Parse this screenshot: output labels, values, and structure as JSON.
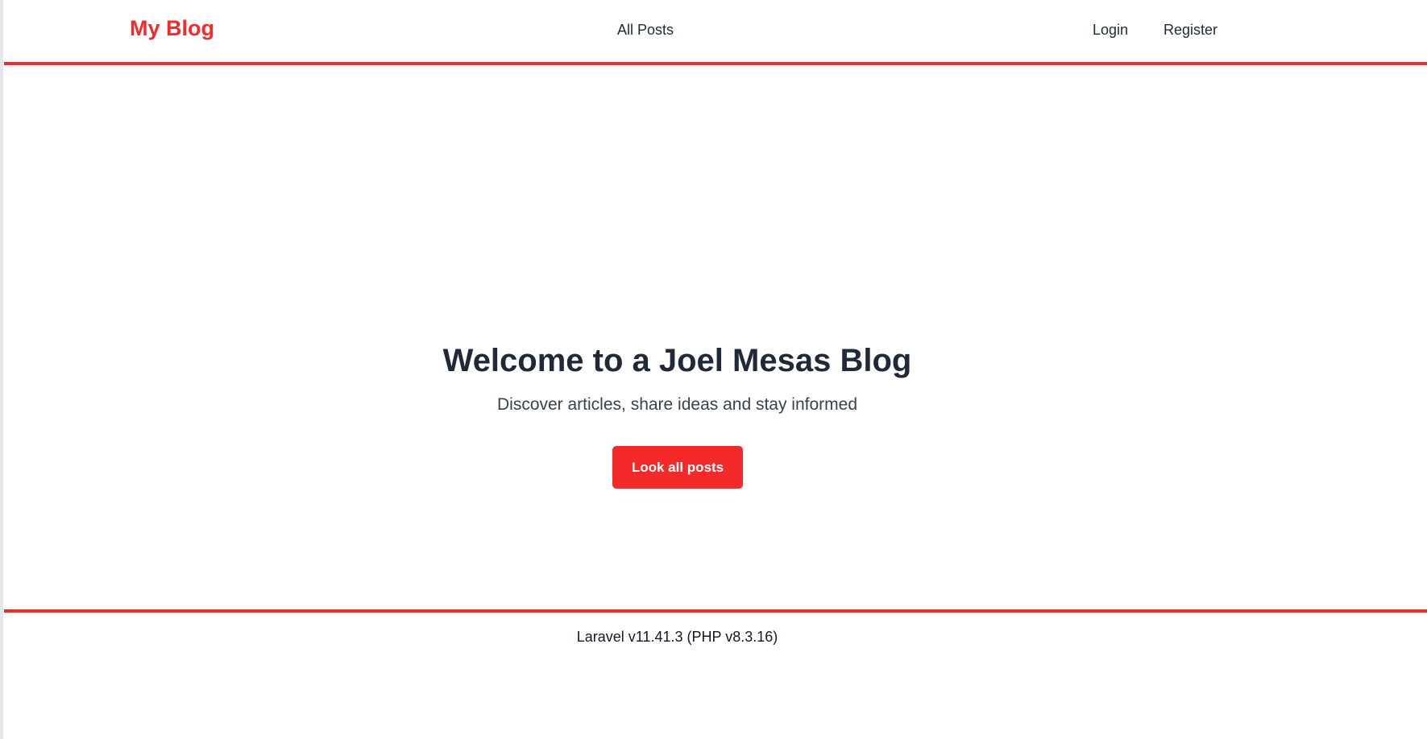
{
  "theme": {
    "accent": "#f4292a"
  },
  "navbar": {
    "brand": "My Blog",
    "links": [
      {
        "label": "All Posts"
      },
      {
        "label": "Login"
      },
      {
        "label": "Register"
      }
    ]
  },
  "hero": {
    "title": "Welcome to a Joel Mesas Blog",
    "subtitle": "Discover articles, share ideas and stay informed",
    "cta_label": "Look all posts"
  },
  "footer": {
    "version_text": "Laravel v11.41.3 (PHP v8.3.16)"
  }
}
